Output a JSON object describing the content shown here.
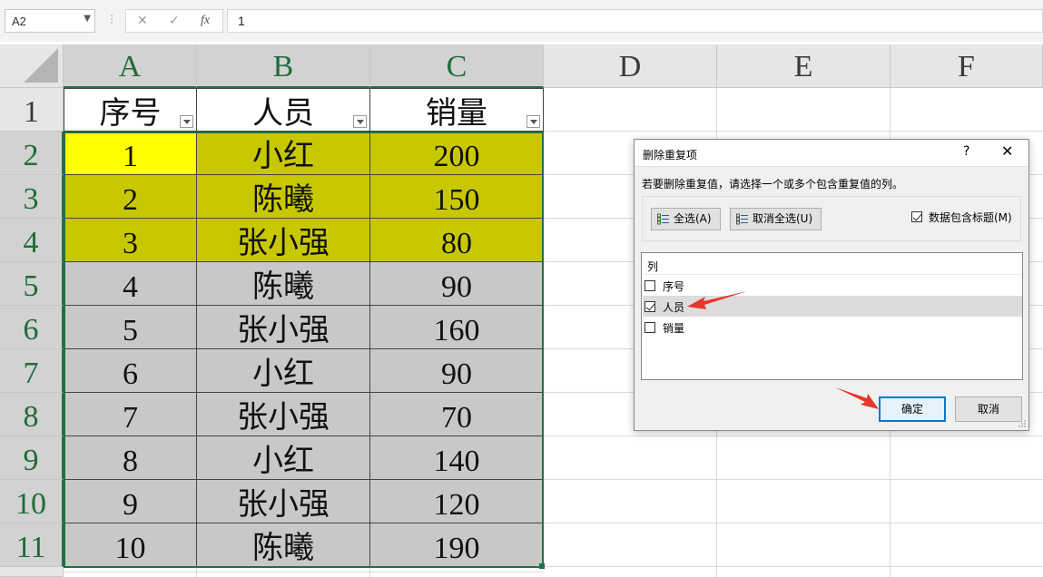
{
  "formula_bar": {
    "name_box": "A2",
    "cancel_icon": "✕",
    "enter_icon": "✓",
    "fx_label": "fx",
    "formula": "1"
  },
  "columns": [
    "A",
    "B",
    "C",
    "D",
    "E",
    "F"
  ],
  "rows": [
    "1",
    "2",
    "3",
    "4",
    "5",
    "6",
    "7",
    "8",
    "9",
    "10",
    "11"
  ],
  "table": {
    "headers": [
      "序号",
      "人员",
      "销量"
    ],
    "data": [
      [
        "1",
        "小红",
        "200"
      ],
      [
        "2",
        "陈曦",
        "150"
      ],
      [
        "3",
        "张小强",
        "80"
      ],
      [
        "4",
        "陈曦",
        "90"
      ],
      [
        "5",
        "张小强",
        "160"
      ],
      [
        "6",
        "小红",
        "90"
      ],
      [
        "7",
        "张小强",
        "70"
      ],
      [
        "8",
        "小红",
        "140"
      ],
      [
        "9",
        "张小强",
        "120"
      ],
      [
        "10",
        "陈曦",
        "190"
      ]
    ]
  },
  "colors": {
    "highlight_active": "#ffff00",
    "highlight_rows": "#c8c800",
    "selection_fill": "#c8c8c8",
    "selection_border": "#1f7244",
    "annotation_arrow": "#e8352b"
  },
  "dialog": {
    "title": "删除重复项",
    "help": "?",
    "close": "✕",
    "prompt": "若要删除重复值，请选择一个或多个包含重复值的列。",
    "select_all": "全选(A)",
    "unselect_all": "取消全选(U)",
    "has_headers_label": "数据包含标题(M)",
    "has_headers_checked": true,
    "list_header": "列",
    "columns": [
      {
        "label": "序号",
        "checked": false
      },
      {
        "label": "人员",
        "checked": true
      },
      {
        "label": "销量",
        "checked": false
      }
    ],
    "ok": "确定",
    "cancel": "取消"
  }
}
